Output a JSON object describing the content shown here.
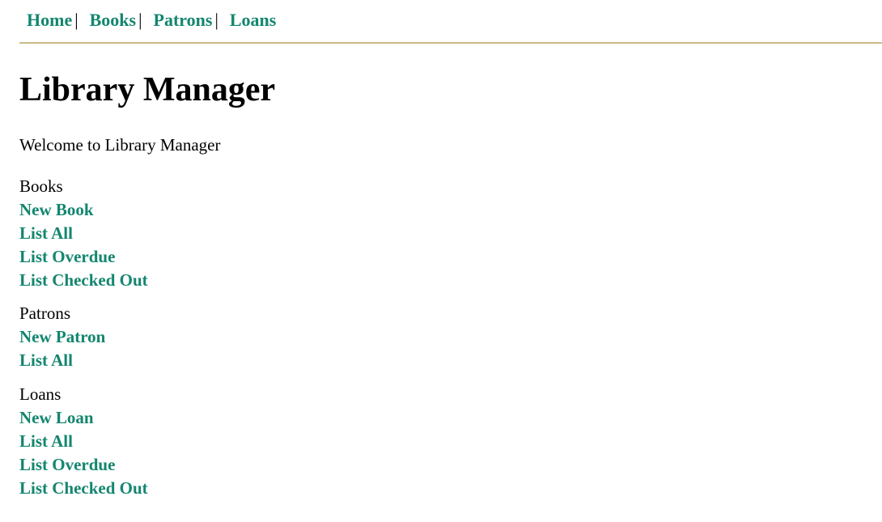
{
  "nav": {
    "items": [
      {
        "label": "Home"
      },
      {
        "label": "Books"
      },
      {
        "label": "Patrons"
      },
      {
        "label": "Loans"
      }
    ],
    "separator": "|"
  },
  "page_title": "Library Manager",
  "welcome": "Welcome to Library Manager",
  "sections": [
    {
      "heading": "Books",
      "links": [
        {
          "label": "New Book"
        },
        {
          "label": "List All"
        },
        {
          "label": "List Overdue"
        },
        {
          "label": "List Checked Out"
        }
      ]
    },
    {
      "heading": "Patrons",
      "links": [
        {
          "label": "New Patron"
        },
        {
          "label": "List All"
        }
      ]
    },
    {
      "heading": "Loans",
      "links": [
        {
          "label": "New Loan"
        },
        {
          "label": "List All"
        },
        {
          "label": "List Overdue"
        },
        {
          "label": "List Checked Out"
        }
      ]
    }
  ],
  "colors": {
    "link": "#13866f",
    "nav_border": "#cdb98a",
    "text": "#000000",
    "background": "#ffffff"
  }
}
